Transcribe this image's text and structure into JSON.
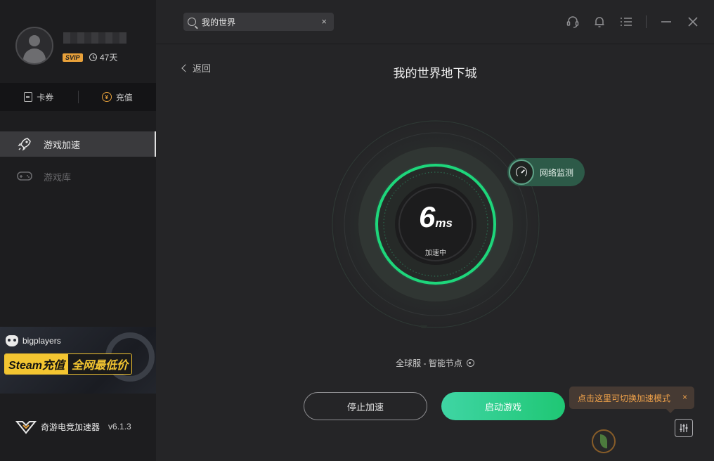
{
  "profile": {
    "badge": "SVIP",
    "days": "47天"
  },
  "wallet": {
    "coupon_label": "卡券",
    "recharge_label": "充值"
  },
  "nav": {
    "items": [
      {
        "label": "游戏加速",
        "icon": "rocket-icon",
        "active": true
      },
      {
        "label": "游戏库",
        "icon": "gamepad-icon",
        "active": false
      }
    ]
  },
  "banner": {
    "brand": "bigplayers",
    "slogan_left": "Steam充值",
    "slogan_right": "全网最低价"
  },
  "app": {
    "name": "奇游电竞加速器",
    "version": "v6.1.3"
  },
  "search": {
    "value": "我的世界",
    "clear": "×"
  },
  "topbar": {
    "icons": [
      "headset-icon",
      "bell-icon",
      "menu-icon",
      "minimize-icon",
      "close-icon"
    ]
  },
  "main": {
    "back_label": "返回",
    "game_title": "我的世界地下城",
    "latency_value": "6",
    "latency_unit": "ms",
    "status": "加速中",
    "monitor_label": "网络监测",
    "node_info": "全球服 - 智能节点",
    "stop_button": "停止加速",
    "start_button": "启动游戏",
    "tooltip": "点击这里可切换加速模式",
    "tooltip_close": "×"
  },
  "colors": {
    "accent_green": "#1fd17a",
    "tooltip_text": "#f0a24a",
    "svip_gold": "#e8a13a",
    "banner_yellow": "#f3c531"
  }
}
